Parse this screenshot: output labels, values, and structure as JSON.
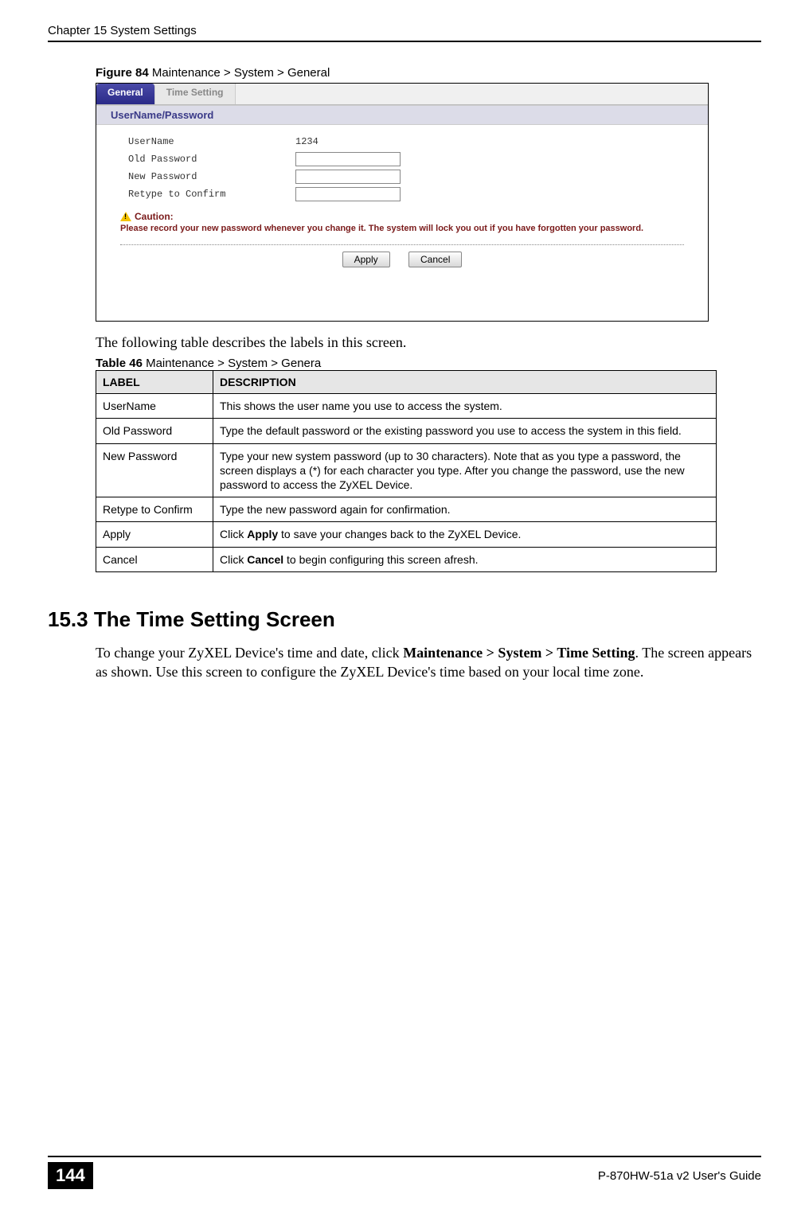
{
  "header": {
    "left": "Chapter 15 System Settings",
    "right": ""
  },
  "figure": {
    "label_bold": "Figure 84",
    "label_rest": "   Maintenance > System > General"
  },
  "screenshot": {
    "tabs": {
      "active": "General",
      "inactive": "Time Setting"
    },
    "group_header": "UserName/Password",
    "rows": {
      "username_label": "UserName",
      "username_value": "1234",
      "oldpw_label": "Old Password",
      "newpw_label": "New Password",
      "retype_label": "Retype to Confirm"
    },
    "caution_title": "Caution:",
    "caution_text": "Please record your new password whenever you change it. The system will lock you out if you have forgotten your password.",
    "apply_btn": "Apply",
    "cancel_btn": "Cancel"
  },
  "para1": "The following table describes the labels in this screen.",
  "table_caption_bold": "Table 46",
  "table_caption_rest": "   Maintenance > System > Genera",
  "table": {
    "head_label": "LABEL",
    "head_desc": "DESCRIPTION",
    "rows": [
      {
        "label": "UserName",
        "desc": "This shows the user name you use to access the system."
      },
      {
        "label": "Old Password",
        "desc": "Type the default password or the existing password you use to access the system in this field."
      },
      {
        "label": "New Password",
        "desc": "Type your new system password (up to 30 characters). Note that as you type a password, the screen displays a (*) for each character you type. After you change the password, use the new password to access the ZyXEL Device."
      },
      {
        "label": "Retype to Confirm",
        "desc": "Type the new password again for confirmation."
      },
      {
        "label": "Apply",
        "desc_pre": "Click ",
        "desc_bold": "Apply",
        "desc_post": " to save your changes back to the ZyXEL Device."
      },
      {
        "label": "Cancel",
        "desc_pre": "Click ",
        "desc_bold": "Cancel",
        "desc_post": " to begin configuring this screen afresh."
      }
    ]
  },
  "section": {
    "heading": "15.3  The Time Setting Screen",
    "body_pre": "To change your ZyXEL Device's time and date, click ",
    "body_bold": "Maintenance > System > Time Setting",
    "body_post": ". The screen appears as shown. Use this screen to configure the ZyXEL Device's time based on your local time zone."
  },
  "footer": {
    "page_num": "144",
    "right": "P-870HW-51a v2 User's Guide"
  }
}
